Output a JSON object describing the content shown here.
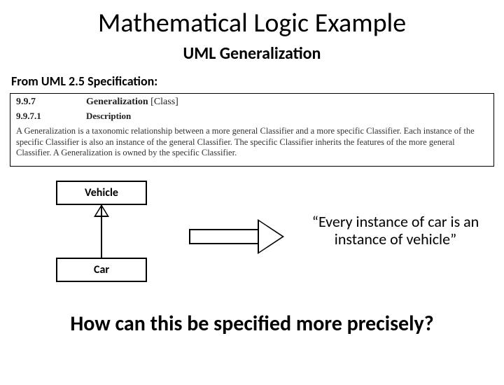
{
  "title": "Mathematical Logic Example",
  "subtitle": "UML Generalization",
  "from_spec": "From UML 2.5 Specification:",
  "spec": {
    "num1": "9.9.7",
    "head1": "Generalization",
    "class_suffix": "[Class]",
    "num2": "9.9.7.1",
    "head2": "Description",
    "body": "A Generalization is a taxonomic relationship between a more general Classifier and a more specific Classifier. Each instance of the specific Classifier is also an instance of the general Classifier. The specific Classifier inherits the features of the more general Classifier. A Generalization is owned by the specific Classifier."
  },
  "uml": {
    "parent": "Vehicle",
    "child": "Car"
  },
  "quote": "“Every instance of car is an instance of vehicle”",
  "question": "How can this be specified more precisely?"
}
